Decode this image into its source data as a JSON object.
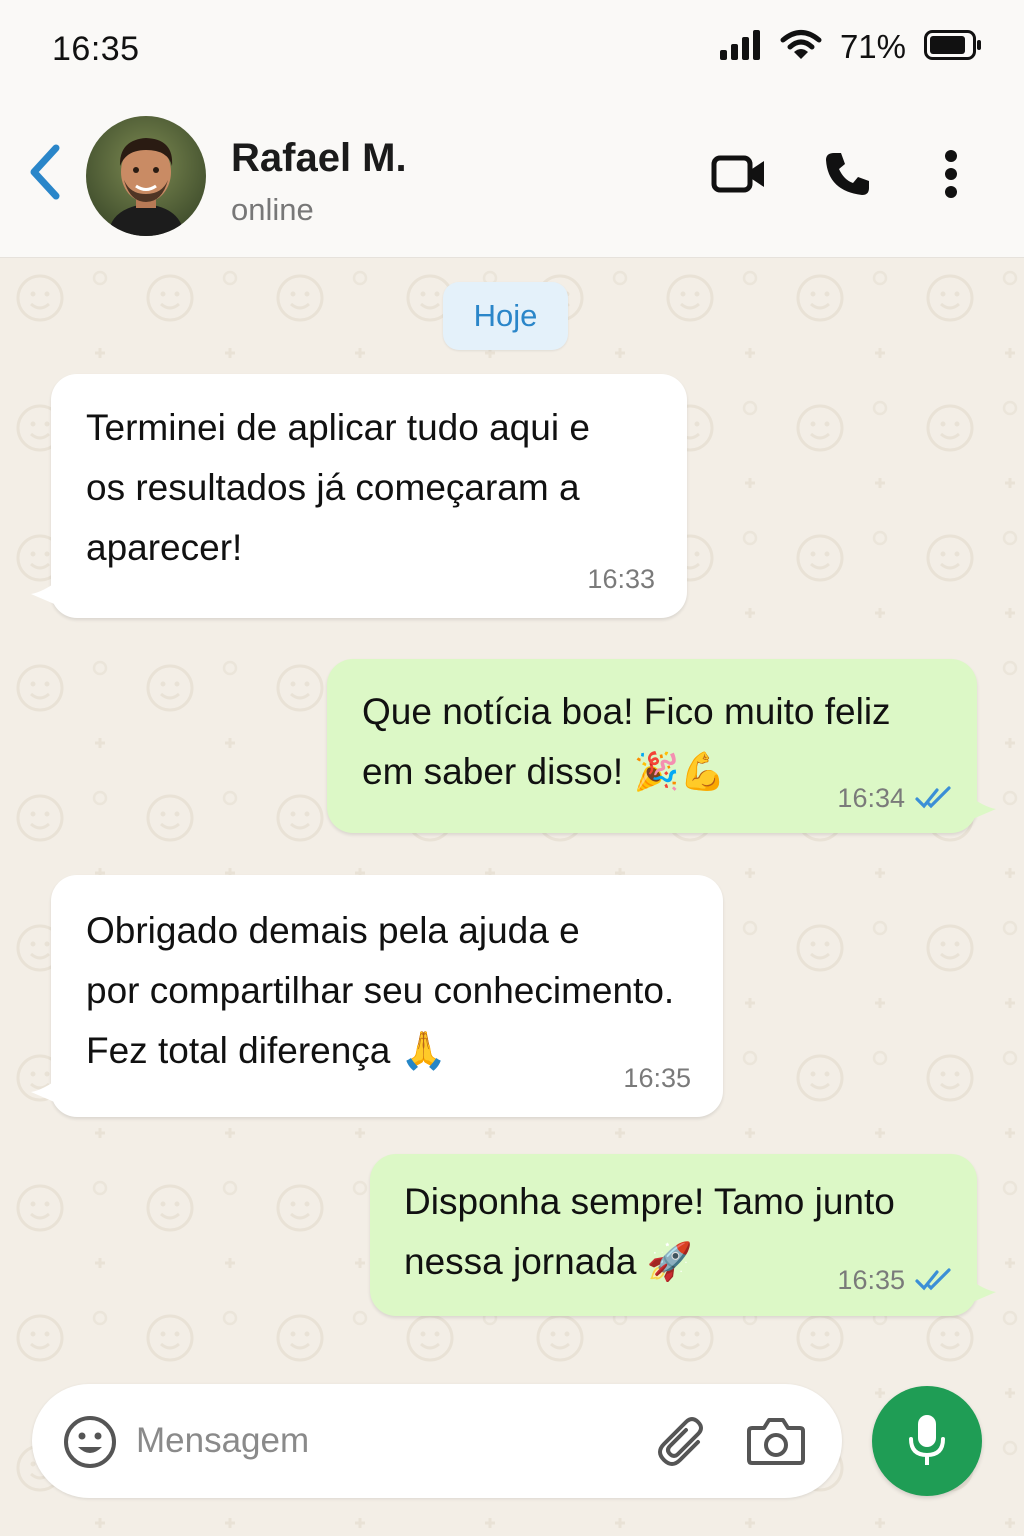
{
  "status_bar": {
    "time": "16:35",
    "battery": "71%",
    "icons": [
      "signal-icon",
      "wifi-icon",
      "battery-icon"
    ]
  },
  "header": {
    "contact_name": "Rafael M.",
    "contact_status": "online",
    "icons": [
      "back-icon",
      "video-call-icon",
      "phone-icon",
      "more-icon"
    ]
  },
  "chat": {
    "date_label": "Hoje",
    "messages": [
      {
        "direction": "incoming",
        "lines": [
          "Terminei de aplicar tudo aqui e",
          "os resultados já começaram a",
          "aparecer!"
        ],
        "time": "16:33"
      },
      {
        "direction": "outgoing",
        "lines": [
          "Que notícia boa! Fico muito feliz",
          "em saber disso!"
        ],
        "emojis": "🎉💪",
        "time": "16:34",
        "read": true
      },
      {
        "direction": "incoming",
        "lines": [
          "Obrigado demais pela ajuda e",
          "por compartilhar seu conhecimento.",
          "Fez total diferença"
        ],
        "emojis": "🙏",
        "time": "16:35"
      },
      {
        "direction": "outgoing",
        "lines": [
          "Disponha sempre! Tamo junto",
          "nessa jornada"
        ],
        "emojis": "🚀",
        "time": "16:35",
        "read": true
      }
    ]
  },
  "composer": {
    "placeholder": "Mensagem",
    "icons": [
      "emoji-icon",
      "attach-icon",
      "camera-icon",
      "mic-icon"
    ]
  },
  "colors": {
    "accent_blue": "#2a86c9",
    "outgoing_bubble": "#dcf8c6",
    "incoming_bubble": "#ffffff",
    "chat_background": "#f3eee6",
    "mic_button": "#1f9d55",
    "read_ticks": "#3b8fd6"
  }
}
